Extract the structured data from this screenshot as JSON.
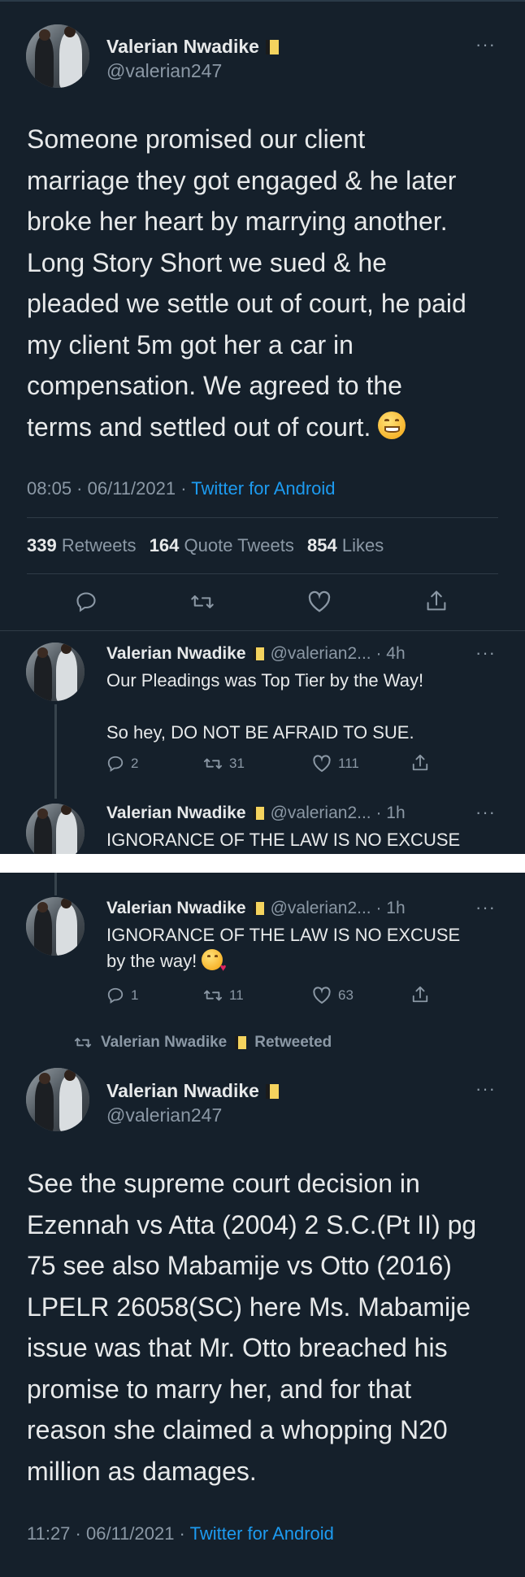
{
  "tweet1": {
    "name": "Valerian Nwadike",
    "handle": "@valerian247",
    "more": "···",
    "lines": [
      "Someone promised our client",
      "marriage they got engaged & he later",
      "broke her heart by marrying another.",
      "Long Story Short we sued & he",
      "pleaded we settle out of court, he paid",
      "my client 5m got her a car in",
      "compensation. We agreed to the",
      "terms and settled out of court."
    ],
    "time": "08:05 · 06/11/2021 · ",
    "source": "Twitter for Android",
    "retweets_count": "339",
    "retweets_label": "Retweets",
    "quotes_count": "164",
    "quotes_label": "Quote Tweets",
    "likes_count": "854",
    "likes_label": "Likes"
  },
  "reply1": {
    "name": "Valerian Nwadike",
    "handle": "@valerian2... · 4h",
    "more": "···",
    "line1": "Our Pleadings was Top Tier by the Way!",
    "line2": "So hey, DO NOT BE AFRAID TO SUE.",
    "replies": "2",
    "retweets": "31",
    "likes": "111"
  },
  "reply2_partial": {
    "name": "Valerian Nwadike",
    "handle": "@valerian2... · 1h",
    "more": "···",
    "line1": "IGNORANCE OF THE LAW IS NO EXCUSE"
  },
  "reply2": {
    "name": "Valerian Nwadike",
    "handle": "@valerian2... · 1h",
    "more": "···",
    "line1": "IGNORANCE OF THE LAW IS NO EXCUSE",
    "line2": "by the way!",
    "replies": "1",
    "retweets": "11",
    "likes": "63"
  },
  "retweet_label": {
    "name": "Valerian Nwadike",
    "text": "Retweeted"
  },
  "tweet2": {
    "name": "Valerian Nwadike",
    "handle": "@valerian247",
    "more": "···",
    "lines": [
      "See the supreme court decision in",
      "Ezennah vs Atta (2004) 2 S.C.(Pt II) pg",
      "75 see also Mabamije vs Otto (2016)",
      "LPELR 26058(SC)  here Ms. Mabamije",
      "issue was that Mr. Otto breached his",
      "promise to marry her, and for that",
      "reason she claimed a whopping N20",
      "million as damages."
    ],
    "time": "11:27 · 06/11/2021 · ",
    "source": "Twitter for Android"
  },
  "icons": {
    "reply": "reply-icon",
    "retweet": "retweet-icon",
    "like": "heart-icon",
    "share": "share-icon",
    "verified_badge": "flag-badge-icon",
    "grin_emoji": "grinning-face-emoji",
    "kiss_emoji": "face-blowing-kiss-emoji"
  },
  "colors": {
    "background": "#15202b",
    "text": "#e7e9ea",
    "secondary": "#8b98a5",
    "link": "#1d9bf0",
    "divider": "#2f3b47"
  }
}
